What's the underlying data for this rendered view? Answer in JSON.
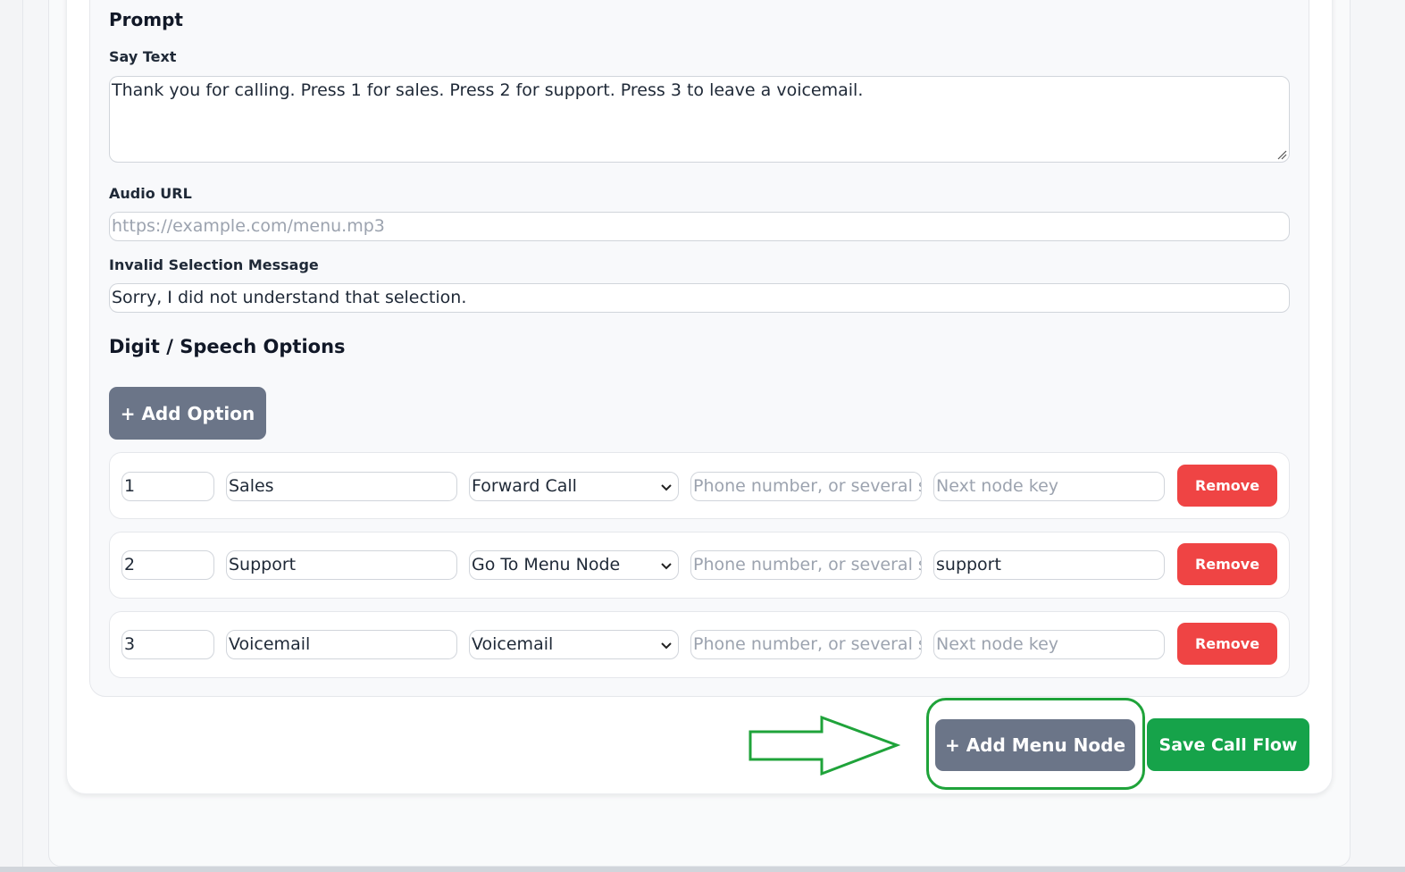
{
  "prompt": {
    "heading": "Prompt",
    "say_text_label": "Say Text",
    "say_text_value": "Thank you for calling. Press 1 for sales. Press 2 for support. Press 3 to leave a voicemail.",
    "audio_url_label": "Audio URL",
    "audio_url_placeholder": "https://example.com/menu.mp3",
    "invalid_label": "Invalid Selection Message",
    "invalid_value": "Sorry, I did not understand that selection."
  },
  "options": {
    "heading": "Digit / Speech Options",
    "add_label": "+ Add Option",
    "phone_placeholder": "Phone number, or several se",
    "next_placeholder": "Next node key",
    "remove_label": "Remove",
    "rows": [
      {
        "digit": "1",
        "label": "Sales",
        "action": "Forward Call",
        "next": ""
      },
      {
        "digit": "2",
        "label": "Support",
        "action": "Go To Menu Node",
        "next": "support"
      },
      {
        "digit": "3",
        "label": "Voicemail",
        "action": "Voicemail",
        "next": ""
      }
    ]
  },
  "footer": {
    "add_menu_node_label": "+ Add Menu Node",
    "save_label": "Save Call Flow"
  },
  "colors": {
    "gray_button": "#6b7588",
    "remove_red": "#ef4444",
    "save_green": "#16a34a",
    "annotation_green": "#1fa33a"
  }
}
